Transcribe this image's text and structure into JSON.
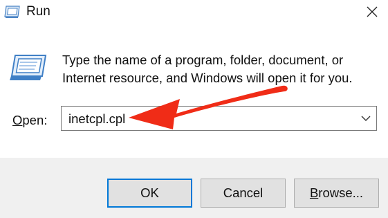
{
  "window": {
    "title": "Run",
    "close_icon": "close-icon",
    "app_icon": "run-icon"
  },
  "body": {
    "description_line1": "Type the name of a program, folder, document, or",
    "description_line2": "Internet resource, and Windows will open it for you.",
    "open_label_mnemonic": "O",
    "open_label_rest": "pen:",
    "open_value": "inetcpl.cpl",
    "dropdown_icon": "chevron-down-icon"
  },
  "buttons": {
    "ok": "OK",
    "cancel": "Cancel",
    "browse_mnemonic": "B",
    "browse_rest": "rowse..."
  },
  "annotation": {
    "arrow_color": "#f02c17",
    "accent_color": "#0078d7"
  }
}
